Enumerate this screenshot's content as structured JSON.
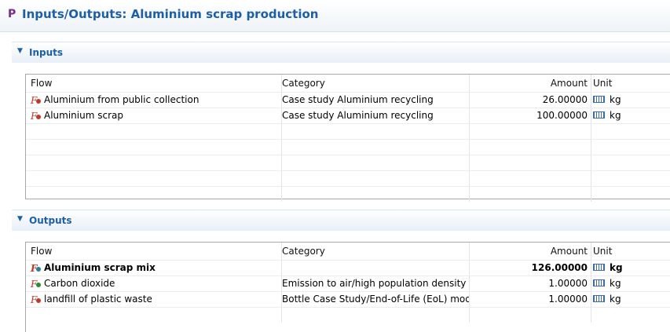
{
  "page": {
    "title": "Inputs/Outputs: Aluminium scrap production",
    "icon": "process-p-icon"
  },
  "columns": {
    "flow": "Flow",
    "category": "Category",
    "amount": "Amount",
    "unit": "Unit"
  },
  "inputs": {
    "label": "Inputs",
    "rows": [
      {
        "flow": "Aluminium from public collection",
        "category": "Case study Aluminium recycling",
        "amount": "26.00000",
        "unit": "kg"
      },
      {
        "flow": "Aluminium scrap",
        "category": "Case study Aluminium recycling",
        "amount": "100.00000",
        "unit": "kg"
      }
    ]
  },
  "outputs": {
    "label": "Outputs",
    "rows": [
      {
        "flow": "Aluminium scrap mix",
        "category": "",
        "amount": "126.00000",
        "unit": "kg"
      },
      {
        "flow": "Carbon dioxide",
        "category": "Emission to air/high population density",
        "amount": "1.00000",
        "unit": "kg"
      },
      {
        "flow": "landfill of plastic waste",
        "category": "Bottle Case Study/End-of-Life (EoL) mod...",
        "amount": "1.00000",
        "unit": "kg"
      }
    ]
  },
  "colors": {
    "accent": "#1d5fa6",
    "product_dot": "#2e7d9a",
    "elementary_dot": "#2e8b2e",
    "waste_dot": "#c0392b"
  }
}
